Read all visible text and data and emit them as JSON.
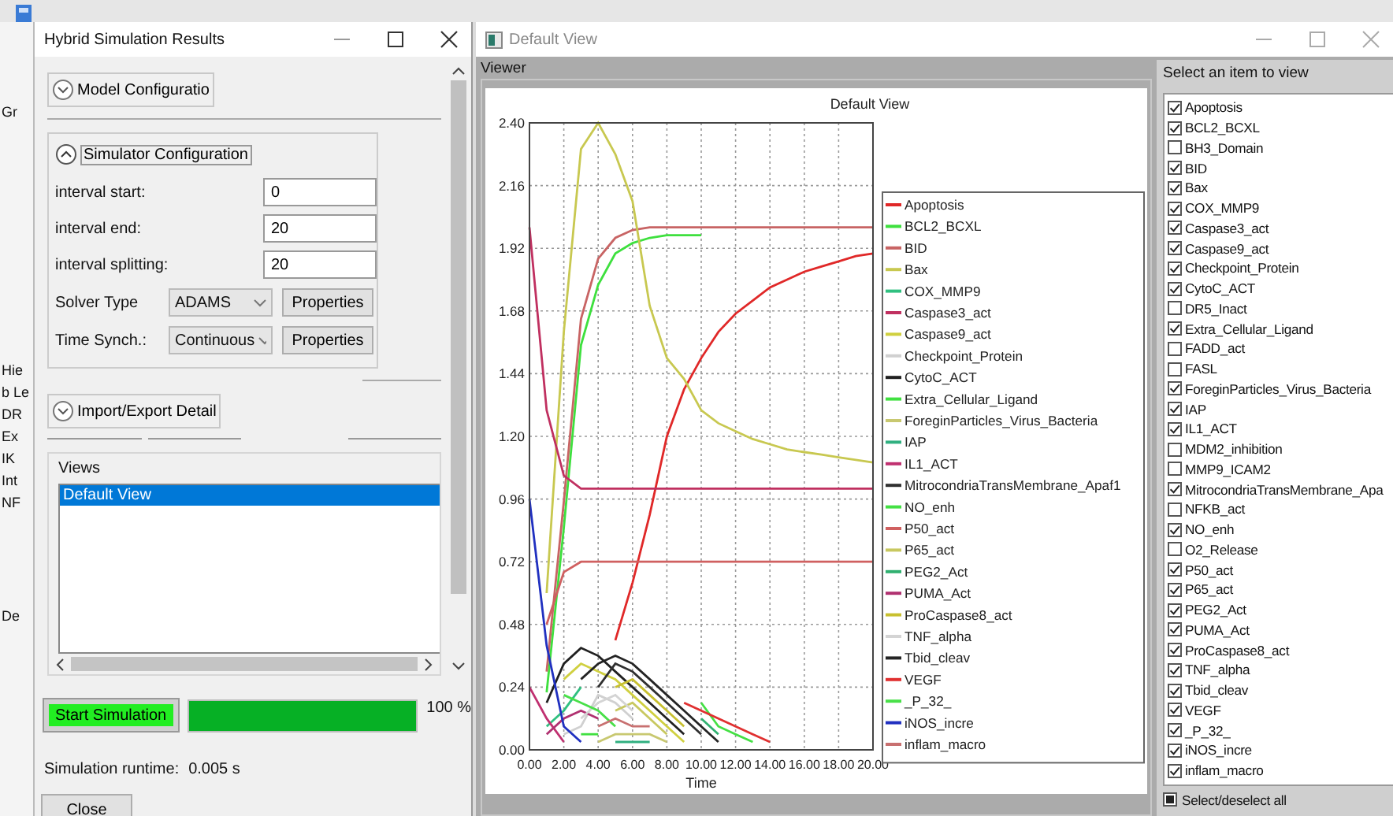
{
  "background_window": {
    "fragment_groups": [
      [
        "Gr"
      ],
      [
        "Hie",
        "b Le",
        "DR",
        "Ex",
        "IK",
        "Int",
        "NF"
      ],
      [
        "De"
      ]
    ]
  },
  "sim_window": {
    "title": "Hybrid Simulation Results",
    "model_section": {
      "label": "Model Configuratio",
      "expanded": false
    },
    "simulator_section": {
      "label": "Simulator Configuration",
      "expanded": true,
      "fields": [
        {
          "label": "interval start:",
          "value": "0"
        },
        {
          "label": "interval end:",
          "value": "20"
        },
        {
          "label": "interval splitting:",
          "value": "20"
        }
      ],
      "selects": [
        {
          "label": "Solver Type",
          "value": "ADAMS",
          "button": "Properties"
        },
        {
          "label": "Time Synch.:",
          "value": "Continuous",
          "button": "Properties"
        }
      ]
    },
    "import_section": {
      "label": "Import/Export Detail",
      "expanded": false
    },
    "views": {
      "label": "Views",
      "items": [
        {
          "label": "Default View",
          "selected": true
        }
      ]
    },
    "start_button": "Start Simulation",
    "progress": {
      "level": 1.0,
      "reading": "100 %"
    },
    "runtime": {
      "label": "Simulation runtime:",
      "value": "0.005 s"
    },
    "close_button": "Close"
  },
  "view_window": {
    "title": "Default View",
    "viewer_label": "Viewer",
    "chart_data": {
      "type": "line",
      "title": "Default View",
      "xlabel": "Time",
      "grid": true,
      "legend": true,
      "x": [
        0,
        1,
        2,
        3,
        4,
        5,
        6,
        7,
        8,
        9,
        10,
        11,
        12,
        13,
        14,
        15,
        16,
        17,
        18,
        19,
        20
      ],
      "xlim": [
        0,
        20
      ],
      "ylim": [
        0,
        2.4
      ],
      "xticks": [
        {
          "value": 0,
          "label": "0.00"
        },
        {
          "value": 2,
          "label": "2.00"
        },
        {
          "value": 4,
          "label": "4.00"
        },
        {
          "value": 6,
          "label": "6.00"
        },
        {
          "value": 8,
          "label": "8.00"
        },
        {
          "value": 10,
          "label": "10.00"
        },
        {
          "value": 12,
          "label": "12.00"
        },
        {
          "value": 14,
          "label": "14.00"
        },
        {
          "value": 16,
          "label": "16.00"
        },
        {
          "value": 18,
          "label": "18.00"
        },
        {
          "value": 20,
          "label": "20.00"
        }
      ],
      "yticks": [
        {
          "value": 0,
          "label": "0.00"
        },
        {
          "value": 0.24,
          "label": "0.24"
        },
        {
          "value": 0.48,
          "label": "0.48"
        },
        {
          "value": 0.72,
          "label": "0.72"
        },
        {
          "value": 0.96,
          "label": "0.96"
        },
        {
          "value": 1.2,
          "label": "1.20"
        },
        {
          "value": 1.44,
          "label": "1.44"
        },
        {
          "value": 1.68,
          "label": "1.68"
        },
        {
          "value": 1.92,
          "label": "1.92"
        },
        {
          "value": 2.16,
          "label": "2.16"
        },
        {
          "value": 2.4,
          "label": "2.40"
        }
      ],
      "series": [
        {
          "name": "Apoptosis",
          "color": "#e02828",
          "values": [
            null,
            null,
            null,
            null,
            null,
            0.42,
            0.64,
            0.9,
            1.2,
            1.38,
            1.5,
            1.6,
            1.67,
            1.72,
            1.77,
            1.8,
            1.83,
            1.85,
            1.87,
            1.89,
            1.9
          ]
        },
        {
          "name": "BCL2_BCXL",
          "color": "#3ee03e",
          "values": [
            null,
            0.22,
            0.85,
            1.55,
            1.78,
            1.9,
            1.94,
            1.96,
            1.97,
            1.97,
            1.97,
            null,
            null,
            null,
            null,
            null,
            null,
            null,
            null,
            null,
            null
          ]
        },
        {
          "name": "BID",
          "color": "#c86464",
          "values": [
            null,
            0.3,
            0.95,
            1.65,
            1.88,
            1.96,
            1.99,
            2.0,
            2.0,
            2.0,
            2.0,
            2.0,
            2.0,
            2.0,
            2.0,
            2.0,
            2.0,
            2.0,
            2.0,
            2.0,
            2.0
          ]
        },
        {
          "name": "Bax",
          "color": "#c8c850",
          "values": [
            null,
            0.6,
            1.6,
            2.3,
            2.4,
            2.28,
            2.1,
            1.7,
            1.5,
            1.42,
            1.3,
            1.25,
            1.22,
            1.19,
            1.17,
            1.15,
            1.14,
            1.13,
            1.12,
            1.11,
            1.1
          ]
        },
        {
          "name": "COX_MMP9",
          "color": "#30c080",
          "values": [
            null,
            0.09,
            0.15,
            0.24,
            null,
            null,
            null,
            null,
            null,
            null,
            null,
            null,
            null,
            null,
            null,
            null,
            null,
            null,
            null,
            null,
            null
          ]
        },
        {
          "name": "Caspase3_act",
          "color": "#c03060",
          "values": [
            2.0,
            1.3,
            1.05,
            1.0,
            1.0,
            1.0,
            1.0,
            1.0,
            1.0,
            1.0,
            1.0,
            1.0,
            1.0,
            1.0,
            1.0,
            1.0,
            1.0,
            1.0,
            1.0,
            1.0,
            1.0
          ]
        },
        {
          "name": "Caspase9_act",
          "color": "#d0d040",
          "values": [
            null,
            null,
            0.27,
            0.33,
            0.3,
            0.27,
            0.21,
            0.15,
            0.09,
            0.03,
            null,
            null,
            null,
            null,
            null,
            null,
            null,
            null,
            null,
            null,
            null
          ]
        },
        {
          "name": "Checkpoint_Protein",
          "color": "#d0d0d0",
          "values": [
            null,
            null,
            0.06,
            0.09,
            0.21,
            0.18,
            0.12,
            null,
            null,
            null,
            null,
            null,
            null,
            null,
            null,
            null,
            null,
            null,
            null,
            null,
            null
          ]
        },
        {
          "name": "CytoC_ACT",
          "color": "#202020",
          "values": [
            null,
            0.18,
            0.33,
            0.39,
            0.36,
            0.3,
            0.24,
            0.18,
            0.12,
            0.06,
            null,
            null,
            null,
            null,
            null,
            null,
            null,
            null,
            null,
            null,
            null
          ]
        },
        {
          "name": "Extra_Cellular_Ligand",
          "color": "#40e040",
          "values": [
            null,
            null,
            null,
            0.06,
            0.06,
            null,
            null,
            null,
            null,
            null,
            null,
            null,
            null,
            null,
            null,
            null,
            null,
            null,
            null,
            null,
            null
          ]
        },
        {
          "name": "ForeginParticles_Virus_Bacteria",
          "color": "#c8c870",
          "values": [
            null,
            null,
            null,
            null,
            0.03,
            0.06,
            0.06,
            0.06,
            0.03,
            null,
            null,
            null,
            null,
            null,
            null,
            null,
            null,
            null,
            null,
            null,
            null
          ]
        },
        {
          "name": "IAP",
          "color": "#30b080",
          "values": [
            null,
            null,
            null,
            null,
            null,
            0.03,
            0.03,
            0.03,
            null,
            null,
            null,
            null,
            null,
            null,
            null,
            null,
            null,
            null,
            null,
            null,
            null
          ]
        },
        {
          "name": "IL1_ACT",
          "color": "#c03070",
          "values": [
            0.24,
            0.12,
            0.03,
            null,
            null,
            null,
            null,
            null,
            null,
            null,
            null,
            null,
            null,
            null,
            null,
            null,
            null,
            null,
            null,
            null,
            null
          ]
        },
        {
          "name": "MitrocondriaTransMembrane_Apaf1",
          "color": "#303030",
          "values": [
            null,
            null,
            null,
            null,
            0.24,
            0.33,
            0.3,
            0.24,
            0.18,
            0.12,
            0.06,
            null,
            null,
            null,
            null,
            null,
            null,
            null,
            null,
            null,
            null
          ]
        },
        {
          "name": "NO_enh",
          "color": "#44e044",
          "values": [
            null,
            null,
            null,
            null,
            null,
            null,
            null,
            null,
            null,
            null,
            0.18,
            0.09,
            0.06,
            0.03,
            null,
            null,
            null,
            null,
            null,
            null,
            null
          ]
        },
        {
          "name": "P50_act",
          "color": "#d06060",
          "values": [
            null,
            0.48,
            0.68,
            0.72,
            0.72,
            0.72,
            0.72,
            0.72,
            0.72,
            0.72,
            0.72,
            0.72,
            0.72,
            0.72,
            0.72,
            0.72,
            0.72,
            0.72,
            0.72,
            0.72,
            0.72
          ]
        },
        {
          "name": "P65_act",
          "color": "#c8c860",
          "values": [
            null,
            null,
            null,
            null,
            null,
            0.15,
            0.18,
            0.12,
            0.06,
            null,
            null,
            null,
            null,
            null,
            null,
            null,
            null,
            null,
            null,
            null,
            null
          ]
        },
        {
          "name": "PEG2_Act",
          "color": "#30b070",
          "values": [
            null,
            null,
            null,
            null,
            null,
            null,
            null,
            null,
            null,
            null,
            0.12,
            0.06,
            null,
            null,
            null,
            null,
            null,
            null,
            null,
            null,
            null
          ]
        },
        {
          "name": "PUMA_Act",
          "color": "#b03070",
          "values": [
            null,
            0.06,
            0.12,
            0.15,
            0.12,
            null,
            null,
            null,
            null,
            null,
            null,
            null,
            null,
            null,
            null,
            null,
            null,
            null,
            null,
            null,
            null
          ]
        },
        {
          "name": "ProCaspase8_act",
          "color": "#c8c030",
          "values": [
            null,
            null,
            null,
            null,
            null,
            0.24,
            0.27,
            0.21,
            0.15,
            0.09,
            null,
            null,
            null,
            null,
            null,
            null,
            null,
            null,
            null,
            null,
            null
          ]
        },
        {
          "name": "TNF_alpha",
          "color": "#d4d4d4",
          "values": [
            null,
            null,
            null,
            0.12,
            0.18,
            0.21,
            0.15,
            null,
            null,
            null,
            null,
            null,
            null,
            null,
            null,
            null,
            null,
            null,
            null,
            null,
            null
          ]
        },
        {
          "name": "Tbid_cleav",
          "color": "#242424",
          "values": [
            null,
            null,
            null,
            0.27,
            0.33,
            0.36,
            0.33,
            0.27,
            0.21,
            0.15,
            0.09,
            0.03,
            null,
            null,
            null,
            null,
            null,
            null,
            null,
            null,
            null
          ]
        },
        {
          "name": "VEGF",
          "color": "#e03030",
          "values": [
            null,
            null,
            null,
            null,
            null,
            null,
            null,
            null,
            null,
            0.18,
            0.15,
            0.12,
            0.09,
            0.06,
            0.03,
            null,
            null,
            null,
            null,
            null,
            null
          ]
        },
        {
          "name": "_P_32_",
          "color": "#48e048",
          "values": [
            null,
            null,
            0.21,
            0.18,
            0.15,
            0.09,
            null,
            null,
            null,
            null,
            null,
            null,
            null,
            null,
            null,
            null,
            null,
            null,
            null,
            null,
            null
          ]
        },
        {
          "name": "iNOS_incre",
          "color": "#2030c0",
          "values": [
            0.96,
            0.4,
            0.09,
            0.03,
            null,
            null,
            null,
            null,
            null,
            null,
            null,
            null,
            null,
            null,
            null,
            null,
            null,
            null,
            null,
            null,
            null
          ]
        },
        {
          "name": "inflam_macro",
          "color": "#c87070",
          "values": [
            null,
            null,
            null,
            null,
            0.09,
            0.12,
            0.09,
            0.09,
            null,
            null,
            null,
            null,
            null,
            null,
            null,
            null,
            null,
            null,
            null,
            null,
            null
          ]
        }
      ]
    },
    "item_panel": {
      "title": "Select an item to view",
      "items": [
        {
          "label": "Apoptosis",
          "checked": true
        },
        {
          "label": "BCL2_BCXL",
          "checked": true
        },
        {
          "label": "BH3_Domain",
          "checked": false
        },
        {
          "label": "BID",
          "checked": true
        },
        {
          "label": "Bax",
          "checked": true
        },
        {
          "label": "COX_MMP9",
          "checked": true
        },
        {
          "label": "Caspase3_act",
          "checked": true
        },
        {
          "label": "Caspase9_act",
          "checked": true
        },
        {
          "label": "Checkpoint_Protein",
          "checked": true
        },
        {
          "label": "CytoC_ACT",
          "checked": true
        },
        {
          "label": "DR5_Inact",
          "checked": false
        },
        {
          "label": "Extra_Cellular_Ligand",
          "checked": true
        },
        {
          "label": "FADD_act",
          "checked": false
        },
        {
          "label": "FASL",
          "checked": false
        },
        {
          "label": "ForeginParticles_Virus_Bacteria",
          "checked": true
        },
        {
          "label": "IAP",
          "checked": true
        },
        {
          "label": "IL1_ACT",
          "checked": true
        },
        {
          "label": "MDM2_inhibition",
          "checked": false
        },
        {
          "label": "MMP9_ICAM2",
          "checked": false
        },
        {
          "label": "MitrocondriaTransMembrane_Apa",
          "checked": true
        },
        {
          "label": "NFKB_act",
          "checked": false
        },
        {
          "label": "NO_enh",
          "checked": true
        },
        {
          "label": "O2_Release",
          "checked": false
        },
        {
          "label": "P50_act",
          "checked": true
        },
        {
          "label": "P65_act",
          "checked": true
        },
        {
          "label": "PEG2_Act",
          "checked": true
        },
        {
          "label": "PUMA_Act",
          "checked": true
        },
        {
          "label": "ProCaspase8_act",
          "checked": true
        },
        {
          "label": "TNF_alpha",
          "checked": true
        },
        {
          "label": "Tbid_cleav",
          "checked": true
        },
        {
          "label": "VEGF",
          "checked": true
        },
        {
          "label": "_P_32_",
          "checked": true
        },
        {
          "label": "iNOS_incre",
          "checked": true
        },
        {
          "label": "inflam_macro",
          "checked": true
        }
      ],
      "select_all": {
        "label": "Select/deselect all",
        "indeterminate": true
      }
    }
  }
}
